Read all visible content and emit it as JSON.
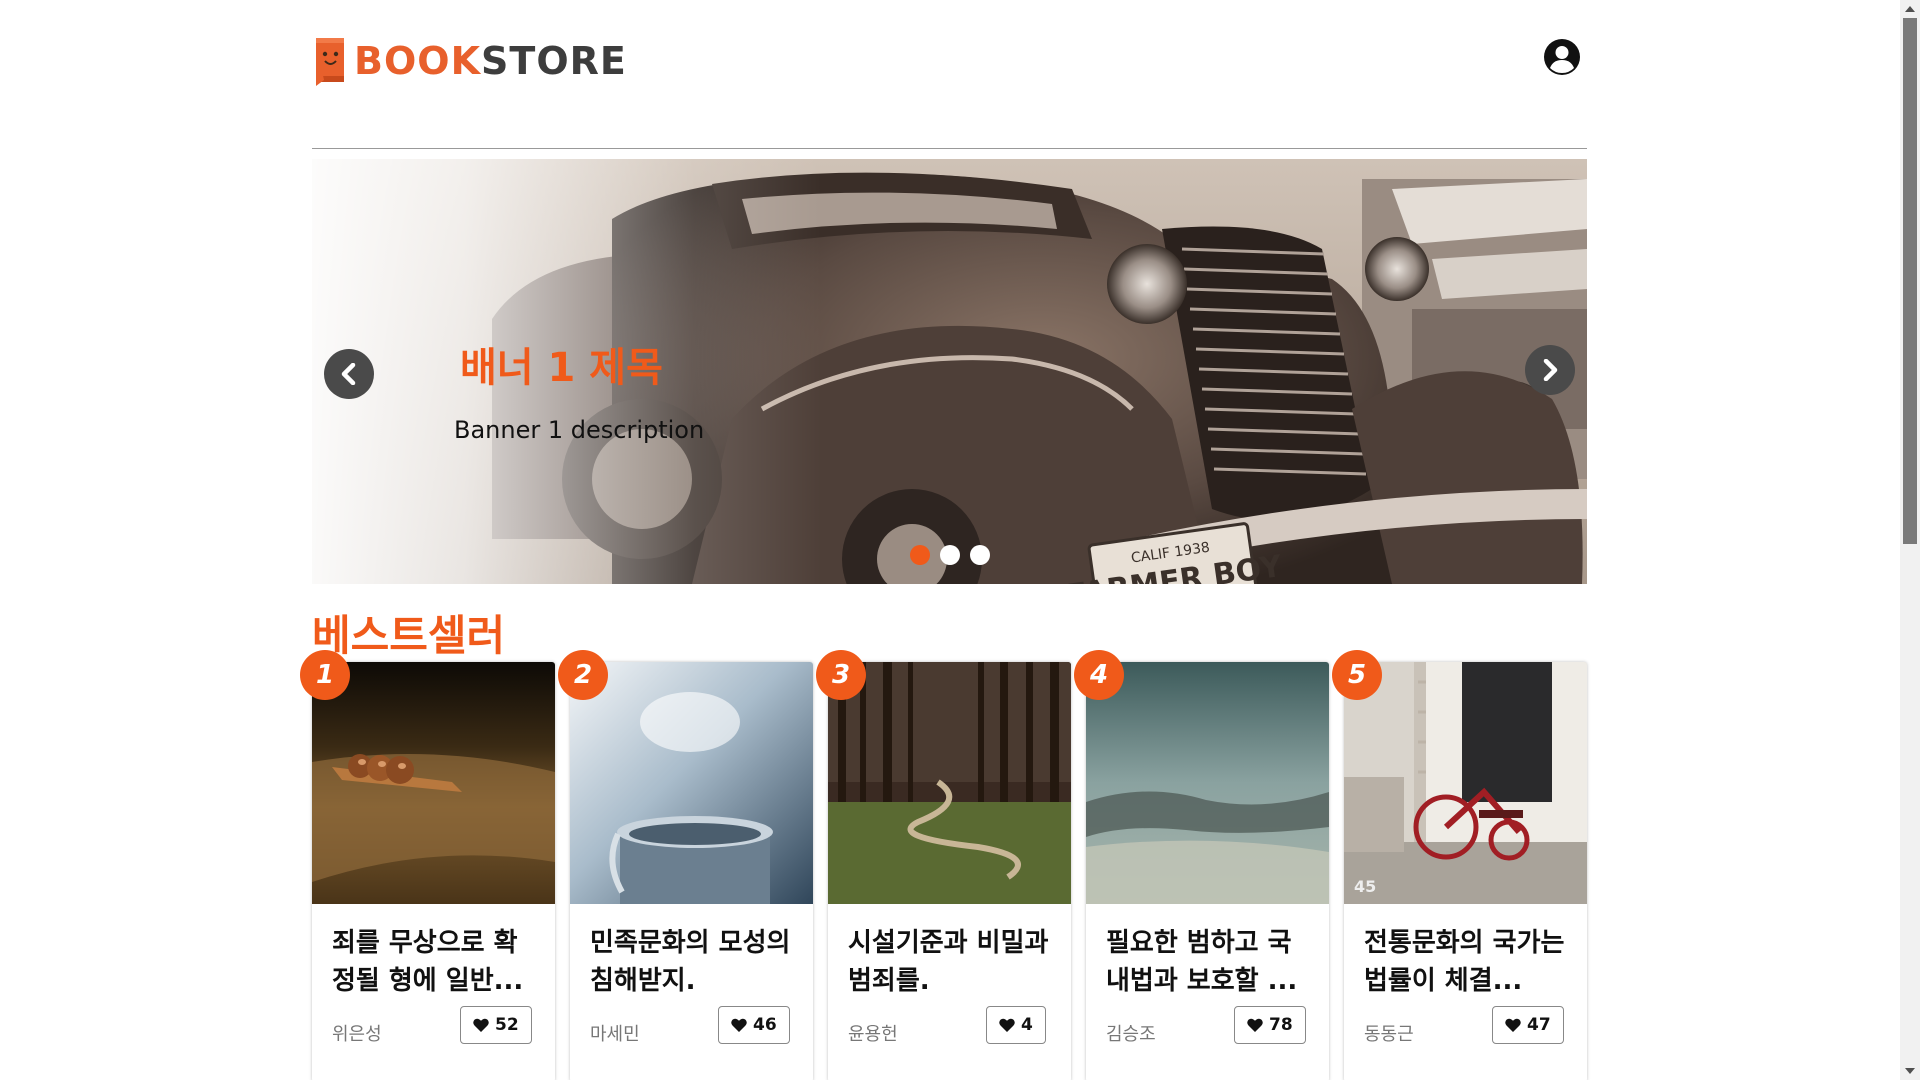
{
  "header": {
    "logo_part1": "BOOK",
    "logo_part2": "STORE",
    "brand_color": "#e8602c"
  },
  "banner": {
    "title": "배너 1 제목",
    "description": "Banner 1 description",
    "slide_count": 3,
    "active_slide": 1
  },
  "bestseller": {
    "heading": "베스트셀러",
    "books": [
      {
        "rank": "1",
        "title": "죄를 무상으로 확정될 형에 일반...",
        "author": "위은성",
        "likes": "52"
      },
      {
        "rank": "2",
        "title": "민족문화의 모성의 침해받지.",
        "author": "마세민",
        "likes": "46"
      },
      {
        "rank": "3",
        "title": "시설기준과 비밀과 범죄를.",
        "author": "윤용헌",
        "likes": "4"
      },
      {
        "rank": "4",
        "title": "필요한 범하고 국내법과 보호할 ...",
        "author": "김승조",
        "likes": "78"
      },
      {
        "rank": "5",
        "title": "전통문화의 국가는 법률이 체결...",
        "author": "동동근",
        "likes": "47"
      }
    ]
  }
}
